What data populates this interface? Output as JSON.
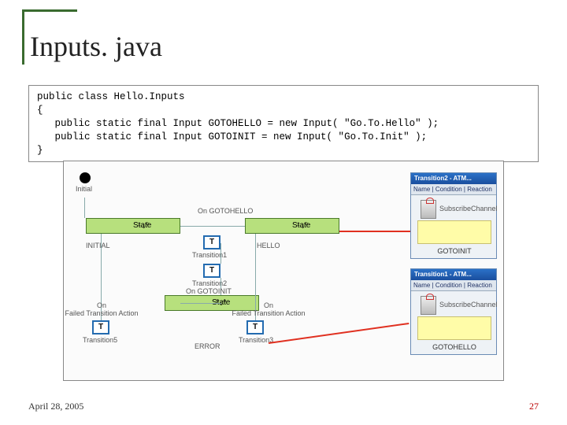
{
  "title": "Inputs. java",
  "code": "public class Hello.Inputs\n{\n   public static final Input GOTOHELLO = new Input( \"Go.To.Hello\" );\n   public static final Input GOTOINIT = new Input( \"Go.To.Init\" );\n}",
  "diagram": {
    "initial_label": "Initial",
    "states": {
      "s1": "State",
      "s2": "State",
      "s3": "State"
    },
    "state_labels": {
      "initial": "INITIAL",
      "hello": "HELLO",
      "error": "ERROR"
    },
    "transitions": {
      "t1": {
        "glyph": "T",
        "label": "Transition1"
      },
      "t2": {
        "glyph": "T",
        "label": "Transition2"
      },
      "t3": {
        "glyph": "T",
        "label": "Transition3"
      },
      "t5": {
        "glyph": "T",
        "label": "Transition5"
      }
    },
    "line_labels": {
      "on_gotohello": "On GOTOHELLO",
      "on_gotoinit": "On GOTOINIT",
      "failed1": "On\nFailed Transition Action",
      "failed2": "On\nFailed Transition Action"
    },
    "panels": {
      "p1": {
        "titlebar": "Transition2 - ATM...",
        "tabs": "Name | Condition | Reaction",
        "sub_label": "SubscribeChannel",
        "label": "GOTOINIT"
      },
      "p2": {
        "titlebar": "Transition1 - ATM...",
        "tabs": "Name | Condition | Reaction",
        "sub_label": "SubscribeChannel",
        "label": "GOTOHELLO"
      }
    }
  },
  "footer": {
    "date": "April 28, 2005",
    "page": "27"
  }
}
